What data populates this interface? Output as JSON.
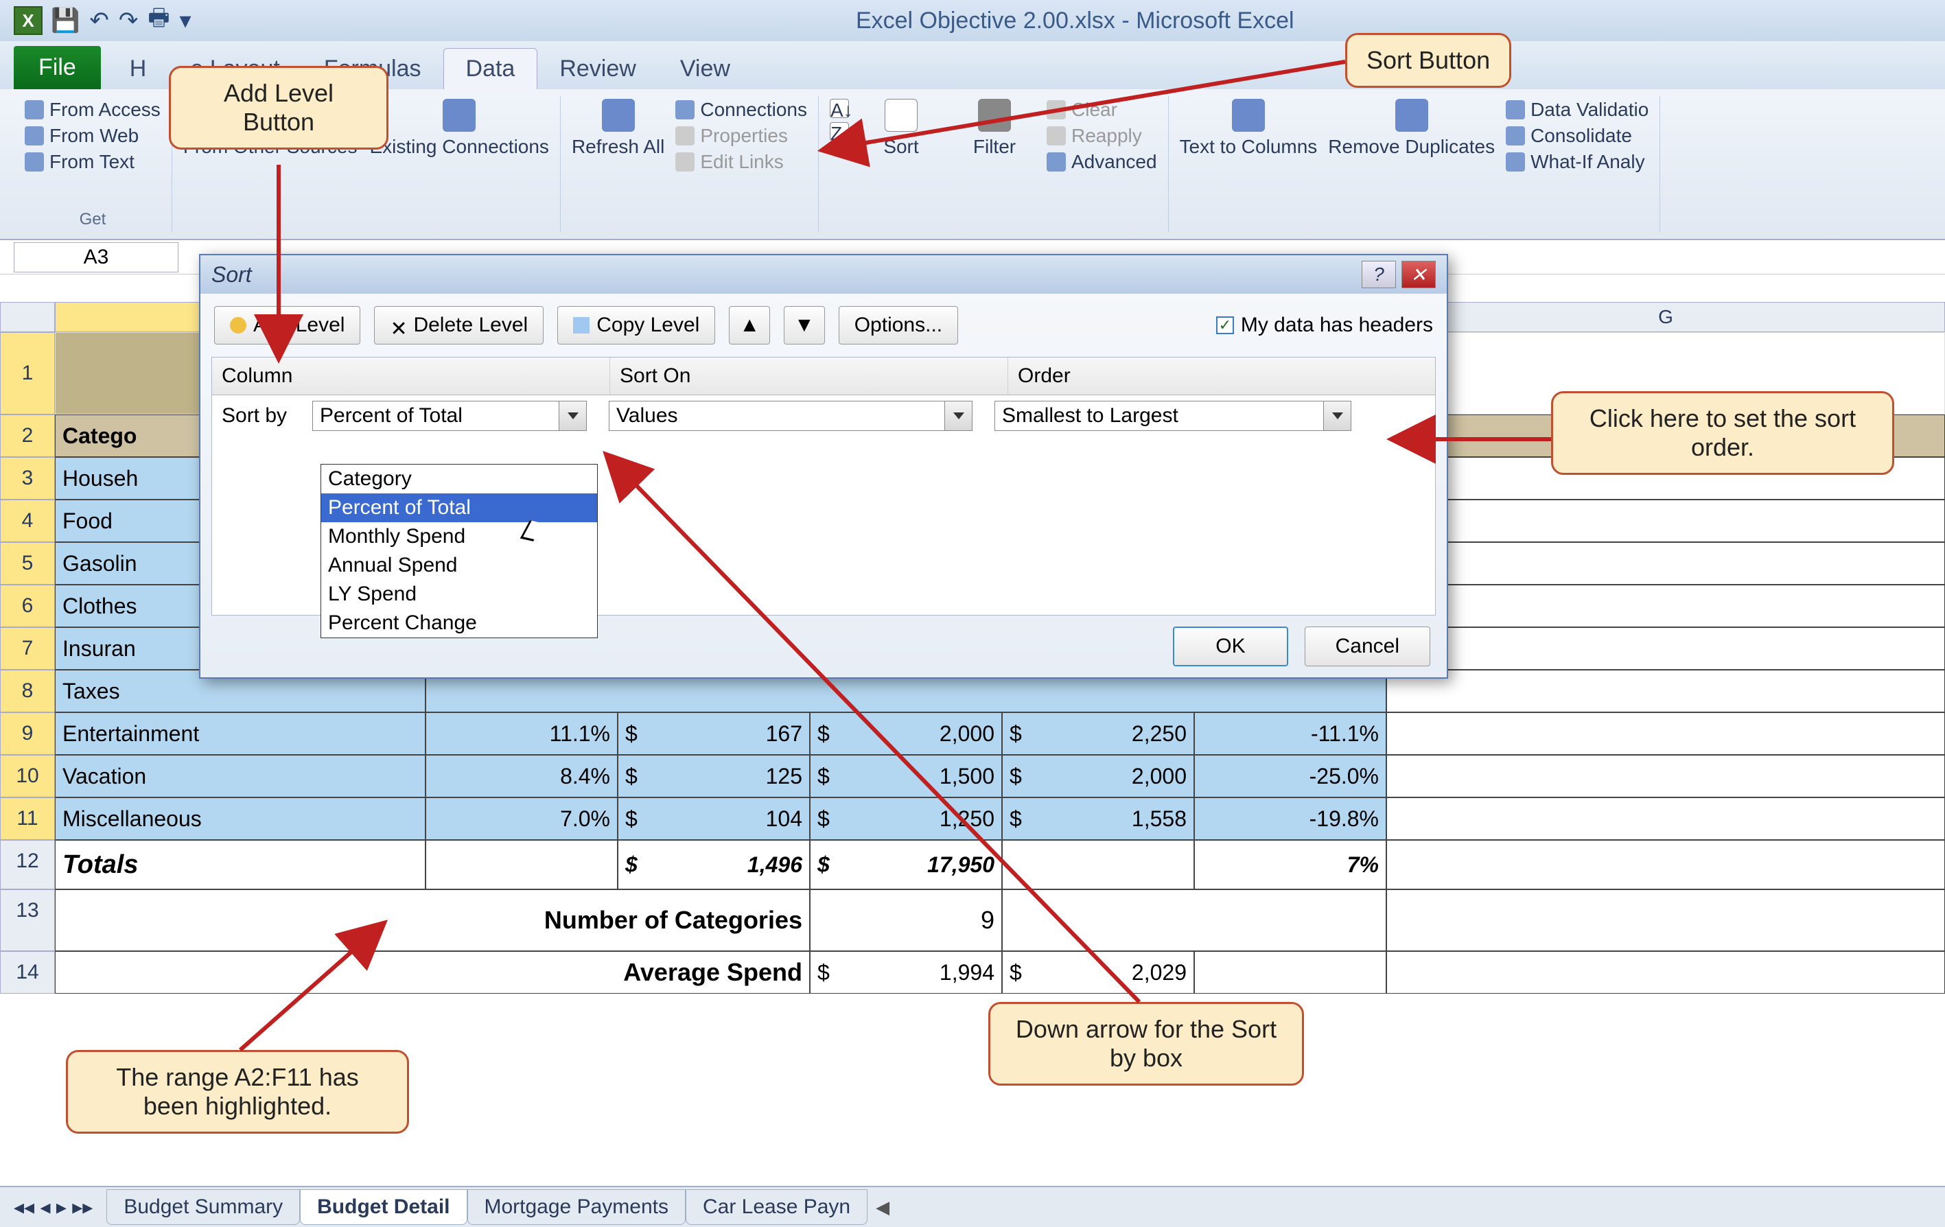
{
  "app": {
    "title": "Excel Objective 2.00.xlsx - Microsoft Excel"
  },
  "tabs": {
    "file": "File",
    "home": "H",
    "pagelayout": "e Layout",
    "formulas": "Formulas",
    "data": "Data",
    "review": "Review",
    "view": "View"
  },
  "ribbon": {
    "get_ext": {
      "from_access": "From Access",
      "from_web": "From Web",
      "from_text": "From Text",
      "from_other": "From Other Sources",
      "existing": "Existing Connections",
      "label": "Get"
    },
    "conn": {
      "refresh": "Refresh All",
      "connections": "Connections",
      "properties": "Properties",
      "edit_links": "Edit Links"
    },
    "sort": {
      "sort": "Sort",
      "filter": "Filter",
      "clear": "Clear",
      "reapply": "Reapply",
      "advanced": "Advanced"
    },
    "tools": {
      "text_to_cols": "Text to Columns",
      "remove_dup": "Remove Duplicates",
      "validation": "Data Validatio",
      "consolidate": "Consolidate",
      "whatif": "What-If Analy"
    }
  },
  "namebox": "A3",
  "colhdr": {
    "A": "",
    "G": "G"
  },
  "rows": {
    "r1": "1",
    "r2": {
      "n": "2",
      "A": "Catego"
    },
    "r3": {
      "n": "3",
      "A": "Househ"
    },
    "r4": {
      "n": "4",
      "A": "Food"
    },
    "r5": {
      "n": "5",
      "A": "Gasolin"
    },
    "r6": {
      "n": "6",
      "A": "Clothes"
    },
    "r7": {
      "n": "7",
      "A": "Insuran"
    },
    "r8": {
      "n": "8",
      "A": "Taxes"
    },
    "r9": {
      "n": "9",
      "A": "Entertainment",
      "B": "11.1%",
      "C": "167",
      "D": "2,000",
      "E": "2,250",
      "F": "-11.1%"
    },
    "r10": {
      "n": "10",
      "A": "Vacation",
      "B": "8.4%",
      "C": "125",
      "D": "1,500",
      "E": "2,000",
      "F": "-25.0%"
    },
    "r11": {
      "n": "11",
      "A": "Miscellaneous",
      "B": "7.0%",
      "C": "104",
      "D": "1,250",
      "E": "1,558",
      "F": "-19.8%"
    },
    "r12": {
      "n": "12",
      "A": "Totals",
      "C": "1,496",
      "D": "17,950",
      "F": "7%"
    },
    "r13": {
      "n": "13",
      "label": "Number of Categories",
      "D": "9"
    },
    "r14": {
      "n": "14",
      "label": "Average Spend",
      "D": "1,994",
      "E": "2,029"
    },
    "dollar": "$"
  },
  "sheets": {
    "s1": "Budget Summary",
    "s2": "Budget Detail",
    "s3": "Mortgage Payments",
    "s4": "Car Lease Payn"
  },
  "dialog": {
    "title": "Sort",
    "add": "Add Level",
    "delete": "Delete Level",
    "copy": "Copy Level",
    "options": "Options...",
    "headers": "My data has headers",
    "col_hdr": "Column",
    "sorton_hdr": "Sort On",
    "order_hdr": "Order",
    "sortby": "Sort by",
    "column_val": "Percent of Total",
    "sorton_val": "Values",
    "order_val": "Smallest to Largest",
    "ok": "OK",
    "cancel": "Cancel",
    "options_list": {
      "o1": "Category",
      "o2": "Percent of Total",
      "o3": "Monthly Spend",
      "o4": "Annual Spend",
      "o5": "LY Spend",
      "o6": "Percent Change"
    }
  },
  "callouts": {
    "add_level": "Add Level Button",
    "sort_button": "Sort Button",
    "order": "Click here to set the sort order.",
    "range": "The range A2:F11 has been highlighted.",
    "down_arrow": "Down arrow for the Sort by box"
  }
}
